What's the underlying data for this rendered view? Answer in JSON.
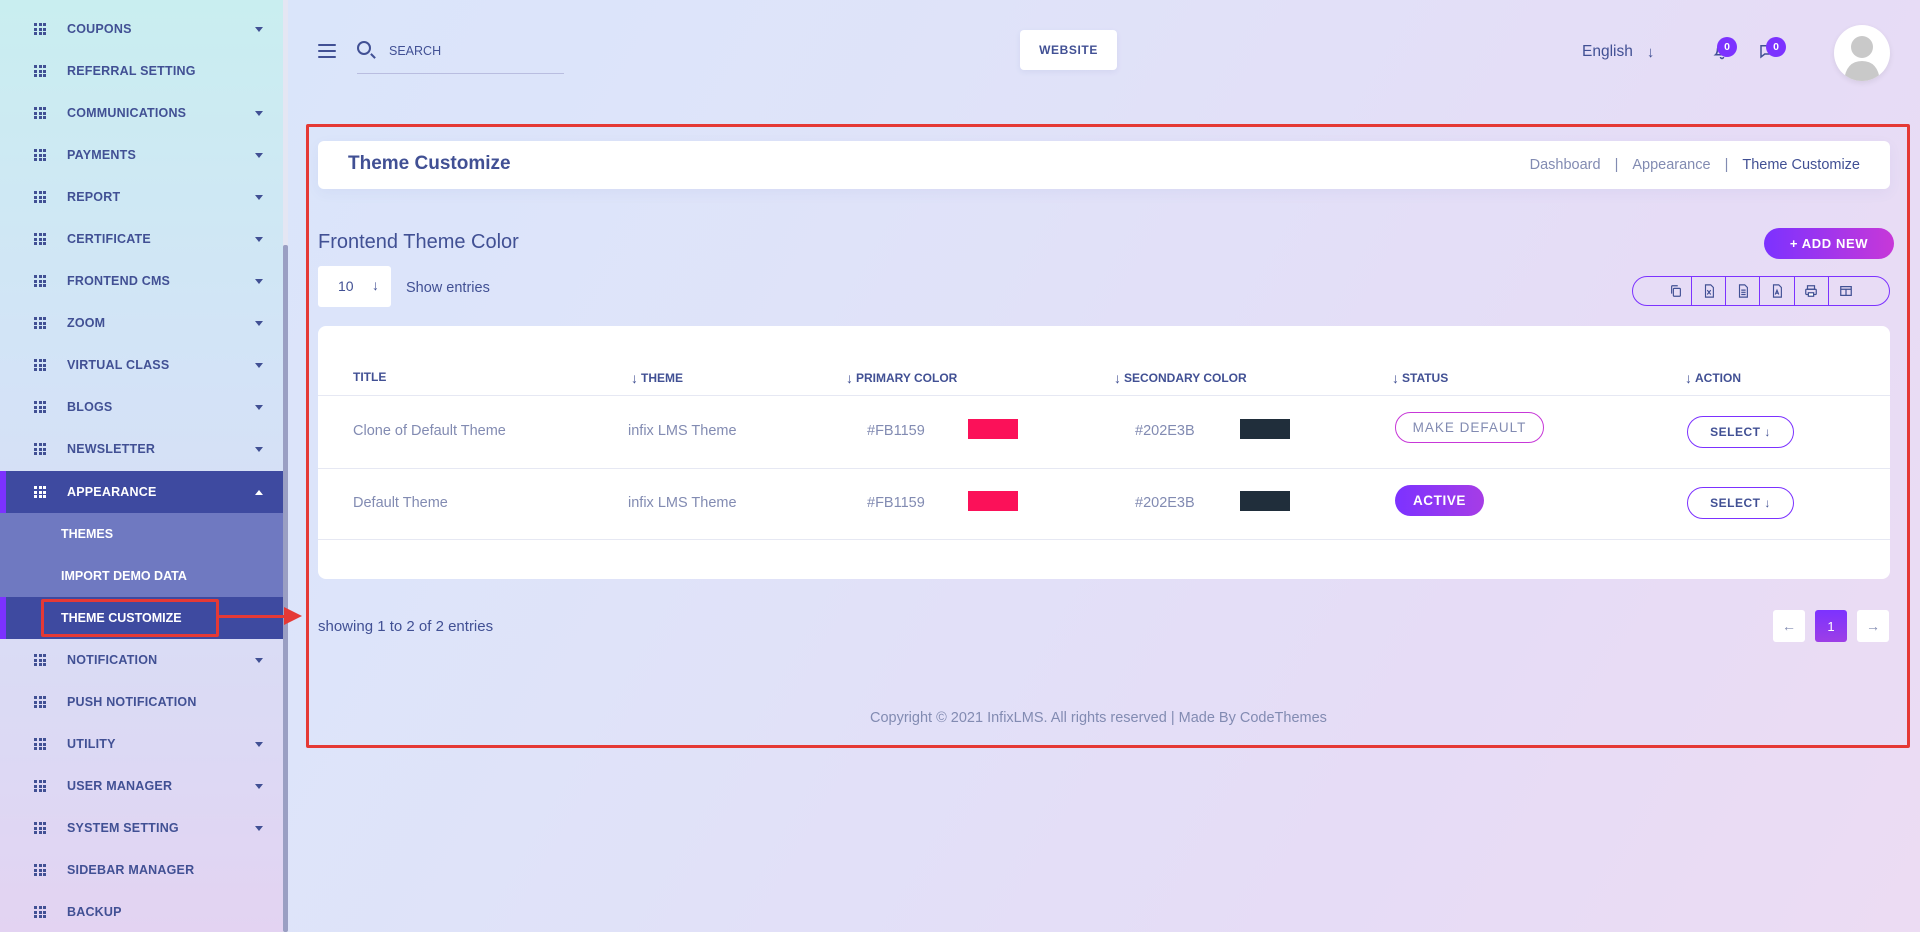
{
  "sidebar": {
    "items": [
      {
        "label": "COUPONS",
        "caret": true
      },
      {
        "label": "REFERRAL SETTING",
        "caret": false
      },
      {
        "label": "COMMUNICATIONS",
        "caret": true
      },
      {
        "label": "PAYMENTS",
        "caret": true
      },
      {
        "label": "REPORT",
        "caret": true
      },
      {
        "label": "CERTIFICATE",
        "caret": true
      },
      {
        "label": "FRONTEND CMS",
        "caret": true
      },
      {
        "label": "ZOOM",
        "caret": true
      },
      {
        "label": "VIRTUAL CLASS",
        "caret": true
      },
      {
        "label": "BLOGS",
        "caret": true
      },
      {
        "label": "NEWSLETTER",
        "caret": true
      },
      {
        "label": "APPEARANCE",
        "caret": true
      },
      {
        "label": "NOTIFICATION",
        "caret": true
      },
      {
        "label": "PUSH NOTIFICATION",
        "caret": false
      },
      {
        "label": "UTILITY",
        "caret": true
      },
      {
        "label": "USER MANAGER",
        "caret": true
      },
      {
        "label": "SYSTEM SETTING",
        "caret": true
      },
      {
        "label": "SIDEBAR MANAGER",
        "caret": false
      },
      {
        "label": "BACKUP",
        "caret": false
      }
    ],
    "sub_items": [
      {
        "label": "THEMES"
      },
      {
        "label": "IMPORT DEMO DATA"
      },
      {
        "label": "THEME CUSTOMIZE"
      }
    ]
  },
  "header": {
    "search_placeholder": "SEARCH",
    "website_label": "WEBSITE",
    "language": "English",
    "notification_count": "0",
    "message_count": "0"
  },
  "page": {
    "title": "Theme Customize",
    "breadcrumb": [
      "Dashboard",
      "Appearance",
      "Theme Customize"
    ],
    "section_title": "Frontend Theme Color",
    "add_new_label": "ADD NEW",
    "entries_value": "10",
    "show_entries_label": "Show entries",
    "showing_text": "showing 1 to 2 of 2 entries",
    "current_page": "1",
    "copyright": "Copyright © 2021 InfixLMS. All rights reserved | Made By CodeThemes"
  },
  "table": {
    "columns": [
      "TITLE",
      "THEME",
      "PRIMARY COLOR",
      "SECONDARY COLOR",
      "STATUS",
      "ACTION"
    ],
    "rows": [
      {
        "title": "Clone of Default Theme",
        "theme": "infix LMS Theme",
        "primary": "#FB1159",
        "secondary": "#202E3B",
        "status": "MAKE DEFAULT",
        "action": "SELECT"
      },
      {
        "title": "Default Theme",
        "theme": "infix LMS Theme",
        "primary": "#FB1159",
        "secondary": "#202E3B",
        "status": "ACTIVE",
        "action": "SELECT"
      }
    ]
  },
  "colors": {
    "accent": "#7c32ff",
    "primary_swatch": "#FB1159",
    "secondary_swatch": "#202E3B",
    "highlight": "#e53935",
    "text": "#415094"
  }
}
